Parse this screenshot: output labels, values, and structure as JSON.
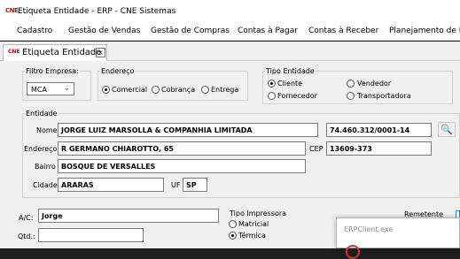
{
  "window": {
    "title": "Etiqueta Entidade - ERP - CNE Sistemas",
    "icon_text": "CNE"
  },
  "menu": [
    "Cadastro",
    "Gestão de Vendas",
    "Gestão de Compras",
    "Contas à Pagar",
    "Contas à Receber",
    "Planejamento de Pr"
  ],
  "tab": {
    "label": "Etiqueta Entidade",
    "close": "×",
    "icon_text": "CNE"
  },
  "filtro": {
    "legend": "Filtro Empresa:",
    "value": "MCA"
  },
  "endereco": {
    "legend": "Endereço",
    "options": [
      "Comercial",
      "Cobrança",
      "Entrega"
    ],
    "selected": "Comercial"
  },
  "tipo_entidade": {
    "legend": "Tipo Entidade",
    "options": [
      "Cliente",
      "Vendedor",
      "Fornecedor",
      "Transportadora"
    ],
    "selected": "Cliente"
  },
  "entidade": {
    "legend": "Entidade",
    "nome_label": "Nome",
    "nome": "JORGE LUIZ MARSOLLA & COMPANHIA LIMITADA",
    "cnpj": "74.460.312/0001-14",
    "endereco_label": "Endereço",
    "endereco": "R GERMANO CHIAROTTO, 65",
    "cep_label": "CEP",
    "cep": "13609-373",
    "bairro_label": "Bairro",
    "bairro": "BOSQUE DE VERSALLES",
    "cidade_label": "Cidade",
    "cidade": "ARARAS",
    "uf_label": "UF",
    "uf": "SP"
  },
  "ac": {
    "label": "A/C:",
    "value": "Jorge"
  },
  "qtd": {
    "label": "Qtd.:",
    "value": ""
  },
  "tipo_impressora": {
    "label": "Tipo Impressora",
    "options": [
      "Matricial",
      "Térmica"
    ],
    "selected": "Térmica"
  },
  "remetente_label": "Remetente",
  "dialog": {
    "title": "ERPClient.exe"
  }
}
